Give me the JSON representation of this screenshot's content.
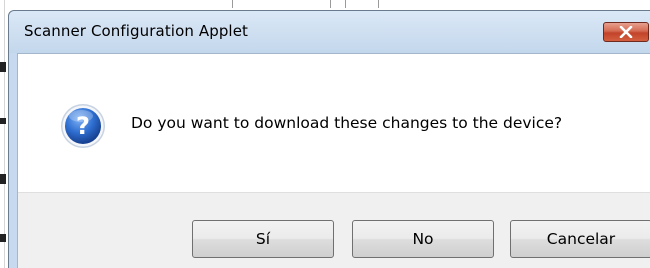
{
  "window": {
    "title": "Scanner Configuration Applet",
    "close_icon": "close-x-icon"
  },
  "dialog": {
    "icon": "question-icon",
    "message": "Do you want to download these changes to the device?",
    "accent_color": "#2f6fd1"
  },
  "buttons": {
    "yes_label": "Sí",
    "no_label": "No",
    "cancel_label": "Cancelar"
  },
  "colors": {
    "titlebar": "#c6d9ee",
    "close_button": "#c9452c",
    "button_area": "#f0f0f0"
  }
}
